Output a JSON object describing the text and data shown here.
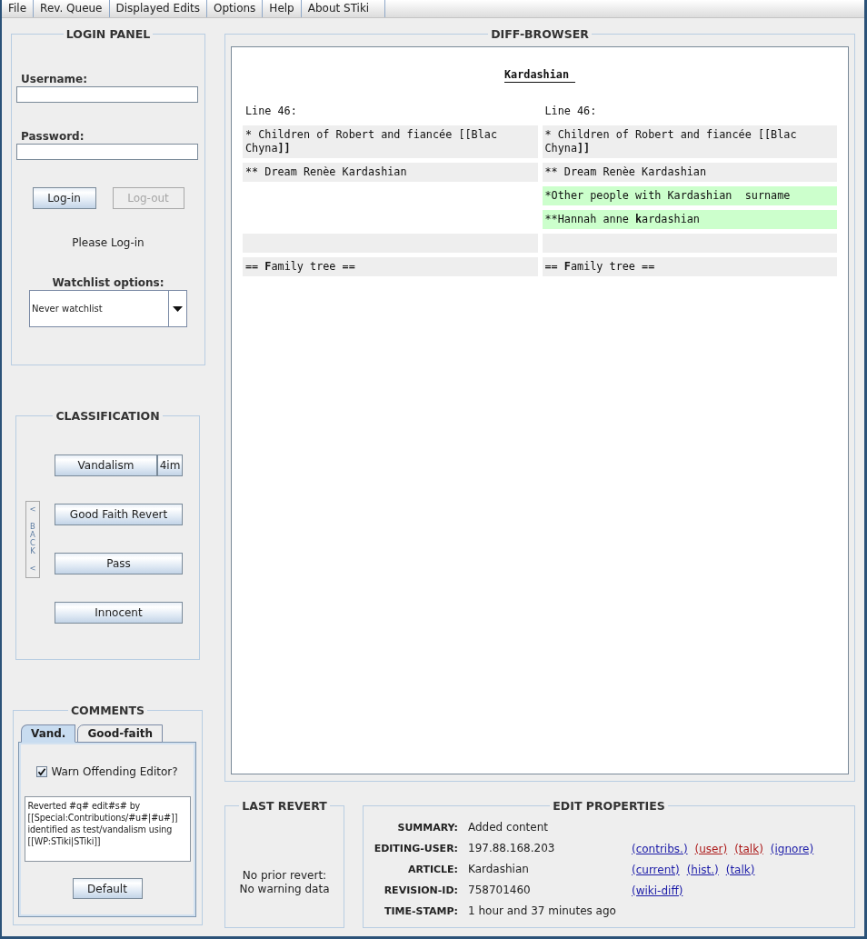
{
  "menu_bar": [
    "File",
    "Rev. Queue",
    "Displayed Edits",
    "Options",
    "Help",
    "About STiki"
  ],
  "login_panel": {
    "title": "LOGIN PANEL",
    "fields": [
      {
        "label": "Username:"
      },
      {
        "label": "Password:"
      }
    ],
    "buttons": [
      {
        "label": "Log-in",
        "disabled": false
      },
      {
        "label": "Log-out",
        "disabled": true
      }
    ],
    "status": "Please Log-in",
    "watchlist": {
      "label": "Watchlist options:",
      "value": "Never watchlist"
    }
  },
  "classification": {
    "title": "CLASSIFICATION",
    "back_button": {
      "label": "< BACK <",
      "disabled": true
    },
    "buttons": [
      {
        "label": "Vandalism",
        "side_label": "4im"
      },
      {
        "label": "Good Faith Revert"
      },
      {
        "label": "Pass"
      },
      {
        "label": "Innocent"
      }
    ]
  },
  "comments": {
    "title": "COMMENTS",
    "tabs": [
      {
        "label": "Vand.",
        "selected": true
      },
      {
        "label": "Good-faith",
        "selected": false
      }
    ],
    "warn_checkbox": {
      "label": "Warn Offending Editor?",
      "checked": true
    },
    "comment_text": "Reverted #q# edit#s# by [[Special:Contributions/#u#|#u#]] identified as test/vandalism using [[WP:STiki|STiki]]",
    "default_button": "Default"
  },
  "diff_browser": {
    "title": "DIFF-BROWSER",
    "article_title": "Kardashian",
    "line_headers": [
      "Line 46:",
      "Line 46:"
    ],
    "rows": [
      {
        "left": {
          "kind": "context",
          "parts": [
            {
              "text": "* Children of Robert and fiancée [[Blac Chyna",
              "bold": false
            },
            {
              "text": "]]",
              "bold": true
            }
          ]
        },
        "right": {
          "kind": "context",
          "parts": [
            {
              "text": "* Children of Robert and fiancée [[Blac Chyna",
              "bold": false
            },
            {
              "text": "]]",
              "bold": true
            }
          ]
        }
      },
      {
        "left": {
          "kind": "context",
          "parts": [
            {
              "text": "** Dream Renèe Kardashian",
              "bold": false
            }
          ]
        },
        "right": {
          "kind": "context",
          "parts": [
            {
              "text": "** Dream Renèe Kardashian",
              "bold": false
            }
          ]
        }
      },
      {
        "left": {
          "kind": "empty"
        },
        "right": {
          "kind": "added",
          "parts": [
            {
              "text": "*Other people with Kardashian  surname",
              "bold": false
            }
          ]
        }
      },
      {
        "left": {
          "kind": "empty"
        },
        "right": {
          "kind": "added",
          "parts": [
            {
              "text": "**Hannah anne ",
              "bold": false
            },
            {
              "text": "k",
              "bold": true
            },
            {
              "text": "ardashian",
              "bold": false
            }
          ]
        }
      },
      {
        "left": {
          "kind": "context"
        },
        "right": {
          "kind": "context"
        }
      },
      {
        "left": {
          "kind": "context",
          "parts": [
            {
              "text": "== ",
              "bold": false
            },
            {
              "text": "F",
              "bold": true
            },
            {
              "text": "amily tree ==",
              "bold": false
            }
          ]
        },
        "right": {
          "kind": "context",
          "parts": [
            {
              "text": "== ",
              "bold": false
            },
            {
              "text": "F",
              "bold": true
            },
            {
              "text": "amily tree ==",
              "bold": false
            }
          ]
        }
      }
    ]
  },
  "last_revert": {
    "title": "LAST REVERT",
    "message": "No prior revert:\nNo warning data"
  },
  "edit_properties": {
    "title": "EDIT PROPERTIES",
    "rows": [
      {
        "label": "SUMMARY:",
        "value": "Added content"
      },
      {
        "label": "EDITING-USER:",
        "value": "197.88.168.203",
        "links": [
          {
            "text": "(contribs.)",
            "color": "#1c1ca8"
          },
          {
            "text": "(user)",
            "color": "#ac1a1a"
          },
          {
            "text": "(talk)",
            "color": "#ac1a1a"
          },
          {
            "text": "(ignore)",
            "color": "#1c1ca8"
          }
        ]
      },
      {
        "label": "ARTICLE:",
        "value": "Kardashian",
        "links": [
          {
            "text": "(current)",
            "color": "#1c1ca8"
          },
          {
            "text": "(hist.)",
            "color": "#1c1ca8"
          },
          {
            "text": "(talk)",
            "color": "#1c1ca8"
          }
        ]
      },
      {
        "label": "REVISION-ID:",
        "value": "758701460",
        "links": [
          {
            "text": "(wiki-diff)",
            "color": "#1c1ca8"
          }
        ]
      },
      {
        "label": "TIME-STAMP:",
        "value": "1 hour and 37 minutes ago"
      }
    ]
  }
}
